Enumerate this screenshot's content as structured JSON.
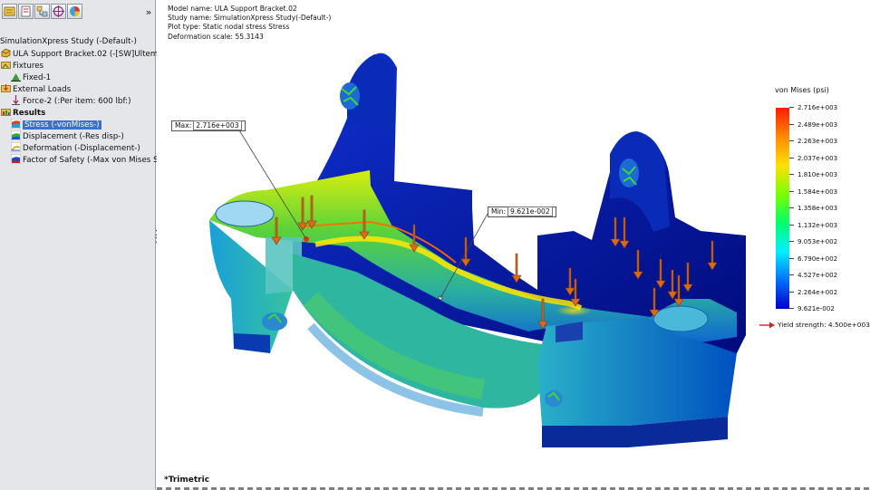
{
  "tree": {
    "study_title": "SimulationXpress Study (-Default-)",
    "part_label": "ULA Support Bracket.02 (-[SW]Ultem 9085",
    "fixtures_label": "Fixtures",
    "fixture_item": "Fixed-1",
    "external_loads_label": "External Loads",
    "force_item": "Force-2 (:Per item: 600 lbf:)",
    "results_label": "Results",
    "results_items": [
      "Stress (-vonMises-)",
      "Displacement (-Res disp-)",
      "Deformation (-Displacement-)",
      "Factor of Safety (-Max von Mises Stres"
    ],
    "selected_item": "Stress (-vonMises-)",
    "expand_glyph": "»"
  },
  "toolbar": {
    "icons": [
      "feature-manager-icon",
      "property-manager-icon",
      "configuration-manager-icon",
      "dimxpert-icon",
      "display-manager-icon"
    ]
  },
  "model_info": {
    "model_name": "Model name: ULA Support Bracket.02",
    "study_name": "Study name: SimulationXpress Study(-Default-)",
    "plot_type": "Plot type: Static nodal stress Stress",
    "deformation_scale": "Deformation scale: 55.3143"
  },
  "legend": {
    "title": "von Mises (psi)",
    "ticks": [
      "2.716e+003",
      "2.489e+003",
      "2.263e+003",
      "2.037e+003",
      "1.810e+003",
      "1.584e+003",
      "1.358e+003",
      "1.132e+003",
      "9.053e+002",
      "6.790e+002",
      "4.527e+002",
      "2.264e+002",
      "9.621e-002"
    ],
    "yield_strength": "Yield strength: 4.500e+003",
    "colors": [
      "#ff1a00",
      "#ff8a00",
      "#ffe000",
      "#7cff00",
      "#00ff6a",
      "#00f0ff",
      "#0070ff",
      "#0000c8"
    ]
  },
  "annotations": {
    "max_label": "Max:",
    "max_value": "2.716e+003",
    "min_label": "Min:",
    "min_value": "9.621e-002"
  },
  "view": {
    "name": "*Trimetric"
  }
}
